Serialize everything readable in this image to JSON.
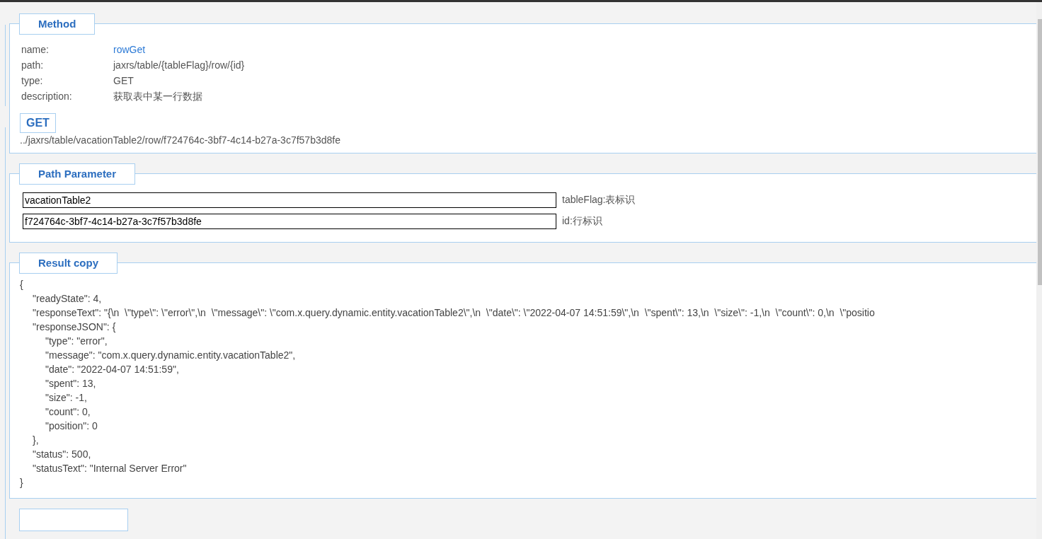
{
  "method": {
    "legend": "Method",
    "fields": [
      {
        "label": "name:",
        "value": "rowGet",
        "kind": "link"
      },
      {
        "label": "path:",
        "value": "jaxrs/table/{tableFlag}/row/{id}",
        "kind": "text"
      },
      {
        "label": "type:",
        "value": "GET",
        "kind": "text"
      },
      {
        "label": "description:",
        "value": "获取表中某一行数据",
        "kind": "text"
      }
    ],
    "badge": "GET",
    "url": "../jaxrs/table/vacationTable2/row/f724764c-3bf7-4c14-b27a-3c7f57b3d8fe"
  },
  "path_parameter": {
    "legend": "Path Parameter",
    "params": [
      {
        "value": "vacationTable2",
        "label": "tableFlag:表标识"
      },
      {
        "value": "f724764c-3bf7-4c14-b27a-3c7f57b3d8fe",
        "label": "id:行标识"
      }
    ]
  },
  "result": {
    "legend": "Result copy",
    "lines": [
      {
        "text": "{",
        "children": [
          {
            "text": "\"readyState\": 4,"
          },
          {
            "text": "\"responseText\": \"{\\n  \\\"type\\\": \\\"error\\\",\\n  \\\"message\\\": \\\"com.x.query.dynamic.entity.vacationTable2\\\",\\n  \\\"date\\\": \\\"2022-04-07 14:51:59\\\",\\n  \\\"spent\\\": 13,\\n  \\\"size\\\": -1,\\n  \\\"count\\\": 0,\\n  \\\"positio"
          },
          {
            "text": "\"responseJSON\": {",
            "children": [
              {
                "text": "\"type\": \"error\","
              },
              {
                "text": "\"message\": \"com.x.query.dynamic.entity.vacationTable2\","
              },
              {
                "text": "\"date\": \"2022-04-07 14:51:59\","
              },
              {
                "text": "\"spent\": 13,"
              },
              {
                "text": "\"size\": -1,"
              },
              {
                "text": "\"count\": 0,"
              },
              {
                "text": "\"position\": 0"
              }
            ]
          },
          {
            "text": "},"
          },
          {
            "text": "\"status\": 500,"
          },
          {
            "text": "\"statusText\": \"Internal Server Error\""
          }
        ]
      },
      {
        "text": "}"
      }
    ]
  }
}
